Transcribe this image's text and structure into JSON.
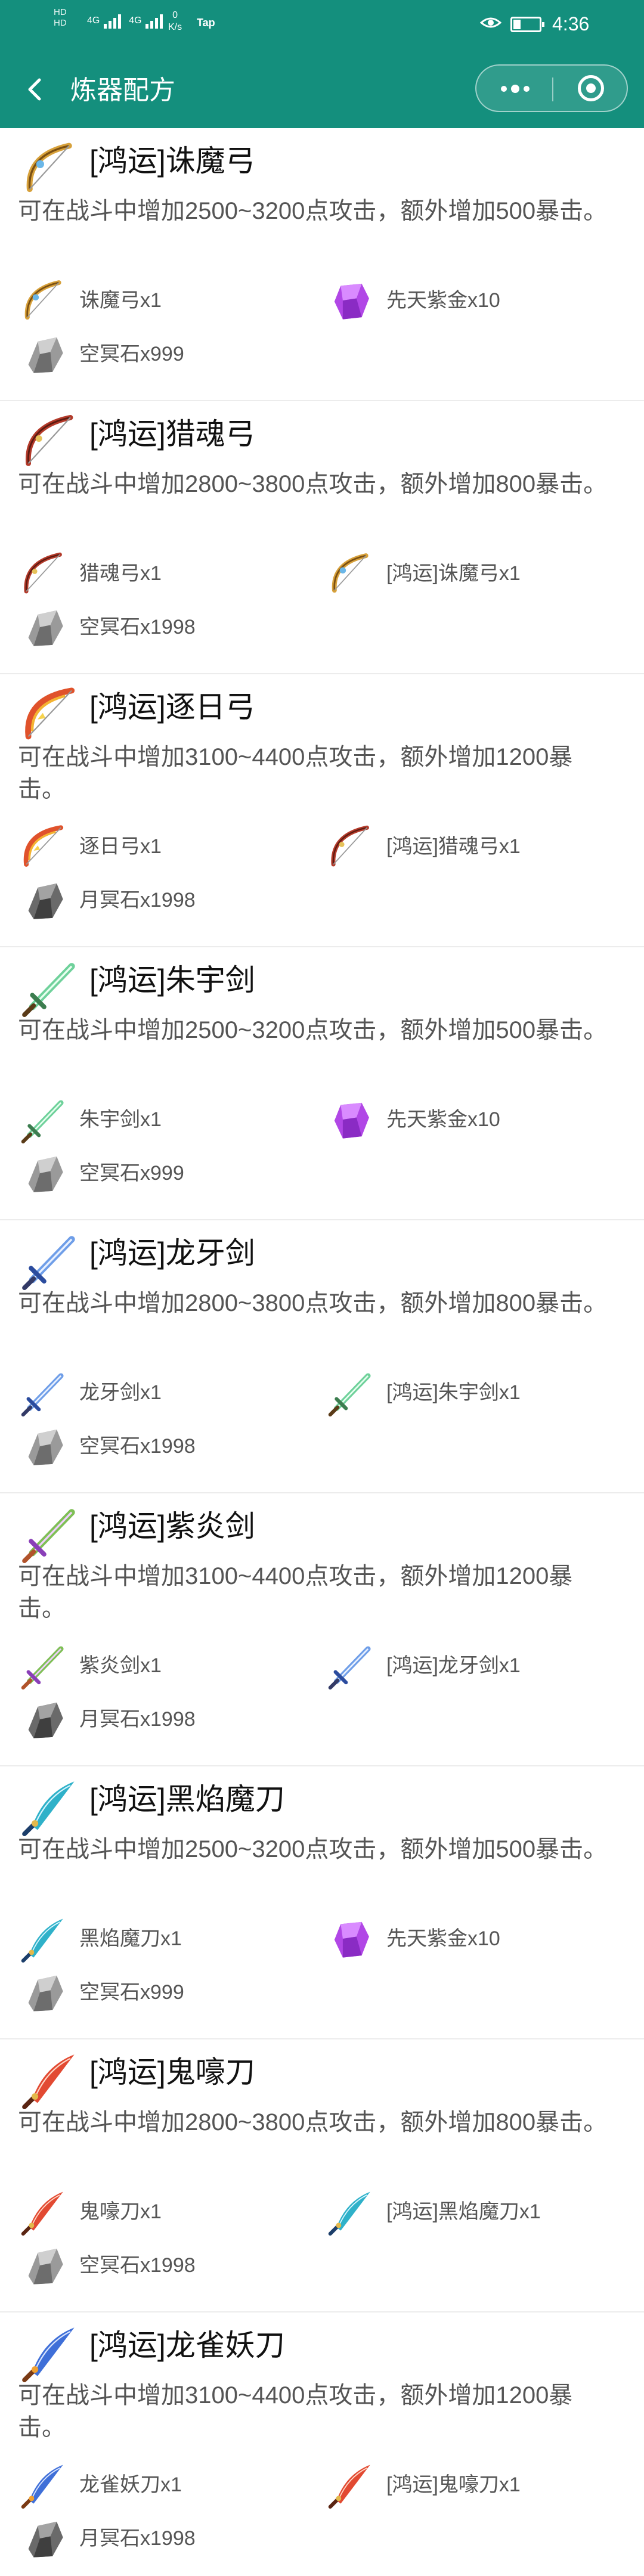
{
  "status_bar": {
    "sim_label_1": "HD",
    "sim_label_2": "HD",
    "signal_1": "4G",
    "signal_2": "4G",
    "net_speed_value": "0",
    "net_speed_unit": "K/s",
    "tap_label": "Tap",
    "time": "4:36"
  },
  "nav": {
    "title": "炼器配方"
  },
  "recipes": [
    {
      "name": "[鸿运]诛魔弓",
      "icon": "bow-gold-icon",
      "desc": "可在战斗中增加2500~3200点攻击，额外增加500暴击。",
      "materials": [
        {
          "label": "诛魔弓x1",
          "icon": "bow-gold-icon"
        },
        {
          "label": "先天紫金x10",
          "icon": "purple-crystal-icon"
        },
        {
          "label": "空冥石x999",
          "icon": "grey-stone-icon"
        }
      ]
    },
    {
      "name": "[鸿运]猎魂弓",
      "icon": "bow-red-icon",
      "desc": "可在战斗中增加2800~3800点攻击，额外增加800暴击。",
      "materials": [
        {
          "label": "猎魂弓x1",
          "icon": "bow-red-icon"
        },
        {
          "label": "[鸿运]诛魔弓x1",
          "icon": "bow-gold-icon"
        },
        {
          "label": "空冥石x1998",
          "icon": "grey-stone-icon"
        }
      ]
    },
    {
      "name": "[鸿运]逐日弓",
      "icon": "bow-flame-icon",
      "desc": "可在战斗中增加3100~4400点攻击，额外增加1200暴击。",
      "materials": [
        {
          "label": "逐日弓x1",
          "icon": "bow-flame-icon"
        },
        {
          "label": "[鸿运]猎魂弓x1",
          "icon": "bow-red-icon"
        },
        {
          "label": "月冥石x1998",
          "icon": "dark-stone-icon"
        }
      ]
    },
    {
      "name": "[鸿运]朱宇剑",
      "icon": "sword-green-icon",
      "desc": "可在战斗中增加2500~3200点攻击，额外增加500暴击。",
      "materials": [
        {
          "label": "朱宇剑x1",
          "icon": "sword-green-icon"
        },
        {
          "label": "先天紫金x10",
          "icon": "purple-crystal-icon"
        },
        {
          "label": "空冥石x999",
          "icon": "grey-stone-icon"
        }
      ]
    },
    {
      "name": "[鸿运]龙牙剑",
      "icon": "sword-blue-icon",
      "desc": "可在战斗中增加2800~3800点攻击，额外增加800暴击。",
      "materials": [
        {
          "label": "龙牙剑x1",
          "icon": "sword-blue-icon"
        },
        {
          "label": "[鸿运]朱宇剑x1",
          "icon": "sword-green-icon"
        },
        {
          "label": "空冥石x1998",
          "icon": "grey-stone-icon"
        }
      ]
    },
    {
      "name": "[鸿运]紫炎剑",
      "icon": "sword-purple-icon",
      "desc": "可在战斗中增加3100~4400点攻击，额外增加1200暴击。",
      "materials": [
        {
          "label": "紫炎剑x1",
          "icon": "sword-purple-icon"
        },
        {
          "label": "[鸿运]龙牙剑x1",
          "icon": "sword-blue-icon"
        },
        {
          "label": "月冥石x1998",
          "icon": "dark-stone-icon"
        }
      ]
    },
    {
      "name": "[鸿运]黑焰魔刀",
      "icon": "blade-teal-icon",
      "desc": "可在战斗中增加2500~3200点攻击，额外增加500暴击。",
      "materials": [
        {
          "label": "黑焰魔刀x1",
          "icon": "blade-teal-icon"
        },
        {
          "label": "先天紫金x10",
          "icon": "purple-crystal-icon"
        },
        {
          "label": "空冥石x999",
          "icon": "grey-stone-icon"
        }
      ]
    },
    {
      "name": "[鸿运]鬼嚎刀",
      "icon": "blade-red-icon",
      "desc": "可在战斗中增加2800~3800点攻击，额外增加800暴击。",
      "materials": [
        {
          "label": "鬼嚎刀x1",
          "icon": "blade-red-icon"
        },
        {
          "label": "[鸿运]黑焰魔刀x1",
          "icon": "blade-teal-icon"
        },
        {
          "label": "空冥石x1998",
          "icon": "grey-stone-icon"
        }
      ]
    },
    {
      "name": "[鸿运]龙雀妖刀",
      "icon": "blade-blue-icon",
      "desc": "可在战斗中增加3100~4400点攻击，额外增加1200暴击。",
      "materials": [
        {
          "label": "龙雀妖刀x1",
          "icon": "blade-blue-icon"
        },
        {
          "label": "[鸿运]鬼嚎刀x1",
          "icon": "blade-red-icon"
        },
        {
          "label": "月冥石x1998",
          "icon": "dark-stone-icon"
        }
      ]
    }
  ],
  "colors": {
    "header_bg": "#148f7d",
    "text_main": "#111111",
    "text_secondary": "#555555",
    "divider": "#ececec"
  }
}
